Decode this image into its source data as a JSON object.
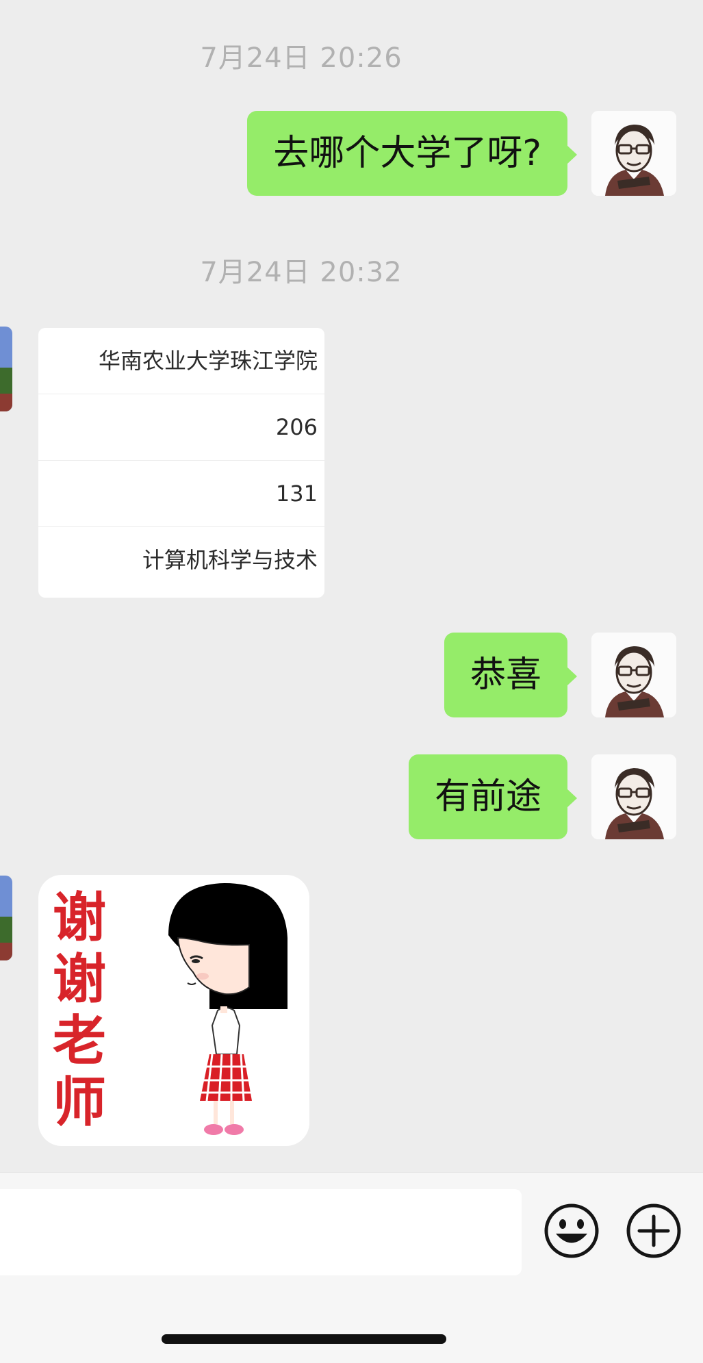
{
  "messages": {
    "timestamp_1": "7月24日 20:26",
    "outgoing_1": "去哪个大学了呀?",
    "timestamp_2": "7月24日 20:32",
    "card_rows": [
      "华南农业大学珠江学院",
      "206",
      "131",
      "计算机科学与技术"
    ],
    "outgoing_2": "恭喜",
    "outgoing_3": "有前途",
    "sticker_text": [
      "谢",
      "谢",
      "老",
      "师"
    ]
  },
  "colors": {
    "outgoing_bubble": "#95ec69",
    "chat_background": "#ededed",
    "sticker_text": "#d8242a"
  },
  "icons": {
    "emoji": "emoji-icon",
    "plus": "plus-icon"
  }
}
